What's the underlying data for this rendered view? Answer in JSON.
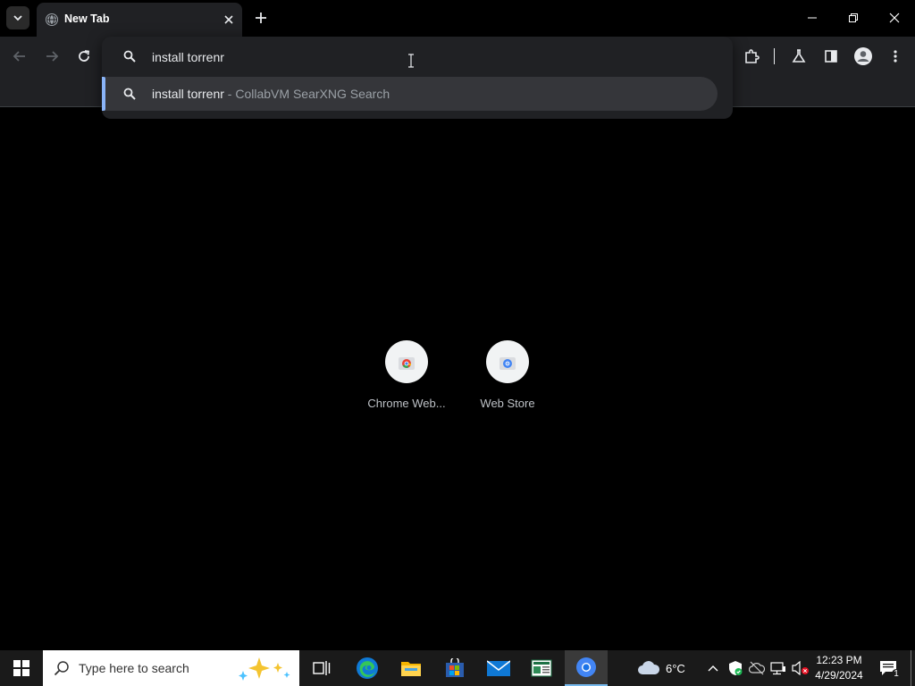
{
  "browser": {
    "tab": {
      "title": "New Tab"
    },
    "omnibox": {
      "value": "install torrenr",
      "suggestion": {
        "query": "install torrenr",
        "description": " - CollabVM SearXNG Search"
      }
    }
  },
  "newtab": {
    "shortcuts": [
      {
        "label": "Chrome Web..."
      },
      {
        "label": "Web Store"
      }
    ]
  },
  "taskbar": {
    "search_placeholder": "Type here to search",
    "weather": {
      "temp": "6°C"
    },
    "clock": {
      "time": "12:23 PM",
      "date": "4/29/2024"
    },
    "notifications_count": "1"
  },
  "colors": {
    "accent": "#8ab4f8",
    "toolbar_bg": "#202124",
    "taskbar_bg": "#1a1a1a"
  }
}
